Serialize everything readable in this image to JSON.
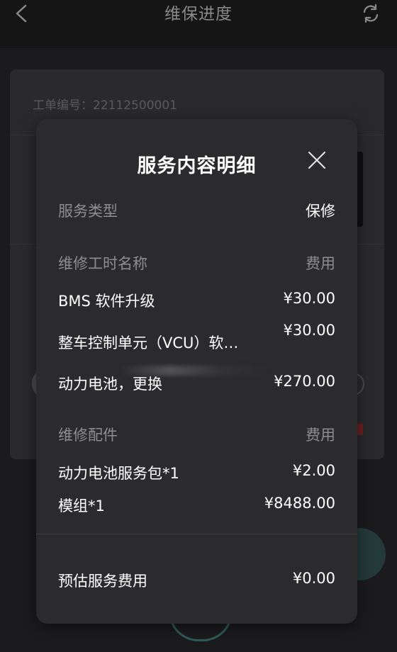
{
  "header": {
    "title": "维保进度"
  },
  "background": {
    "order_label": "工单编号：22112500001"
  },
  "modal": {
    "title": "服务内容明细",
    "service_type": {
      "label": "服务类型",
      "value": "保修"
    },
    "labor": {
      "header_label": "维修工时名称",
      "header_fee": "费用",
      "items": [
        {
          "name": "BMS 软件升级",
          "price": "¥30.00"
        },
        {
          "name": "整车控制单元（VCU）软…",
          "price": "¥30.00"
        },
        {
          "name": "动力电池，更换",
          "price": "¥270.00"
        }
      ]
    },
    "parts": {
      "header_label": "维修配件",
      "header_fee": "费用",
      "items": [
        {
          "name": "动力电池服务包*1",
          "price": "¥2.00"
        },
        {
          "name": "模组*1",
          "price": "¥8488.00"
        }
      ]
    },
    "total": {
      "label": "预估服务费用",
      "value": "¥0.00"
    }
  },
  "colors": {
    "background": "#1b1b1d",
    "modal": "#2b2b2d",
    "label_gray": "#8e8e92",
    "accent_teal": "#2f5a58"
  }
}
